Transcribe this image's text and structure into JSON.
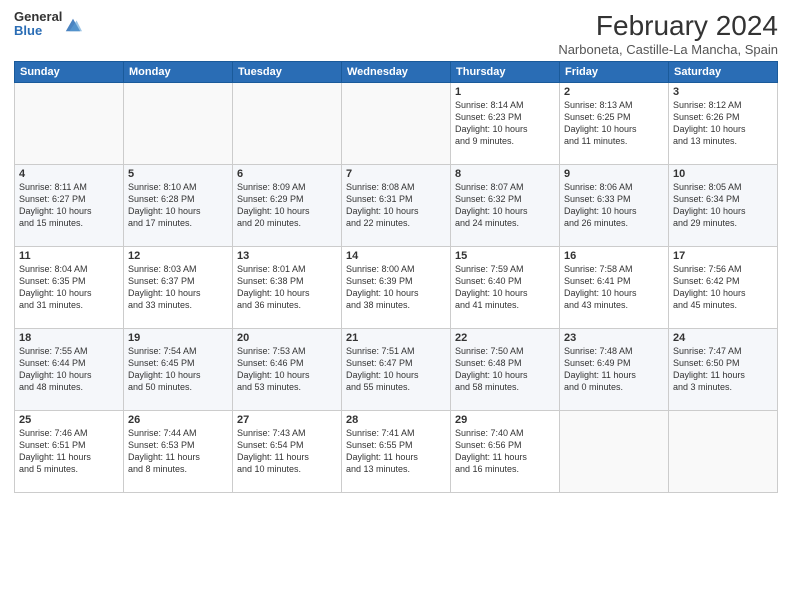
{
  "logo": {
    "general": "General",
    "blue": "Blue"
  },
  "title": "February 2024",
  "subtitle": "Narboneta, Castille-La Mancha, Spain",
  "days_of_week": [
    "Sunday",
    "Monday",
    "Tuesday",
    "Wednesday",
    "Thursday",
    "Friday",
    "Saturday"
  ],
  "weeks": [
    [
      {
        "day": "",
        "info": ""
      },
      {
        "day": "",
        "info": ""
      },
      {
        "day": "",
        "info": ""
      },
      {
        "day": "",
        "info": ""
      },
      {
        "day": "1",
        "info": "Sunrise: 8:14 AM\nSunset: 6:23 PM\nDaylight: 10 hours\nand 9 minutes."
      },
      {
        "day": "2",
        "info": "Sunrise: 8:13 AM\nSunset: 6:25 PM\nDaylight: 10 hours\nand 11 minutes."
      },
      {
        "day": "3",
        "info": "Sunrise: 8:12 AM\nSunset: 6:26 PM\nDaylight: 10 hours\nand 13 minutes."
      }
    ],
    [
      {
        "day": "4",
        "info": "Sunrise: 8:11 AM\nSunset: 6:27 PM\nDaylight: 10 hours\nand 15 minutes."
      },
      {
        "day": "5",
        "info": "Sunrise: 8:10 AM\nSunset: 6:28 PM\nDaylight: 10 hours\nand 17 minutes."
      },
      {
        "day": "6",
        "info": "Sunrise: 8:09 AM\nSunset: 6:29 PM\nDaylight: 10 hours\nand 20 minutes."
      },
      {
        "day": "7",
        "info": "Sunrise: 8:08 AM\nSunset: 6:31 PM\nDaylight: 10 hours\nand 22 minutes."
      },
      {
        "day": "8",
        "info": "Sunrise: 8:07 AM\nSunset: 6:32 PM\nDaylight: 10 hours\nand 24 minutes."
      },
      {
        "day": "9",
        "info": "Sunrise: 8:06 AM\nSunset: 6:33 PM\nDaylight: 10 hours\nand 26 minutes."
      },
      {
        "day": "10",
        "info": "Sunrise: 8:05 AM\nSunset: 6:34 PM\nDaylight: 10 hours\nand 29 minutes."
      }
    ],
    [
      {
        "day": "11",
        "info": "Sunrise: 8:04 AM\nSunset: 6:35 PM\nDaylight: 10 hours\nand 31 minutes."
      },
      {
        "day": "12",
        "info": "Sunrise: 8:03 AM\nSunset: 6:37 PM\nDaylight: 10 hours\nand 33 minutes."
      },
      {
        "day": "13",
        "info": "Sunrise: 8:01 AM\nSunset: 6:38 PM\nDaylight: 10 hours\nand 36 minutes."
      },
      {
        "day": "14",
        "info": "Sunrise: 8:00 AM\nSunset: 6:39 PM\nDaylight: 10 hours\nand 38 minutes."
      },
      {
        "day": "15",
        "info": "Sunrise: 7:59 AM\nSunset: 6:40 PM\nDaylight: 10 hours\nand 41 minutes."
      },
      {
        "day": "16",
        "info": "Sunrise: 7:58 AM\nSunset: 6:41 PM\nDaylight: 10 hours\nand 43 minutes."
      },
      {
        "day": "17",
        "info": "Sunrise: 7:56 AM\nSunset: 6:42 PM\nDaylight: 10 hours\nand 45 minutes."
      }
    ],
    [
      {
        "day": "18",
        "info": "Sunrise: 7:55 AM\nSunset: 6:44 PM\nDaylight: 10 hours\nand 48 minutes."
      },
      {
        "day": "19",
        "info": "Sunrise: 7:54 AM\nSunset: 6:45 PM\nDaylight: 10 hours\nand 50 minutes."
      },
      {
        "day": "20",
        "info": "Sunrise: 7:53 AM\nSunset: 6:46 PM\nDaylight: 10 hours\nand 53 minutes."
      },
      {
        "day": "21",
        "info": "Sunrise: 7:51 AM\nSunset: 6:47 PM\nDaylight: 10 hours\nand 55 minutes."
      },
      {
        "day": "22",
        "info": "Sunrise: 7:50 AM\nSunset: 6:48 PM\nDaylight: 10 hours\nand 58 minutes."
      },
      {
        "day": "23",
        "info": "Sunrise: 7:48 AM\nSunset: 6:49 PM\nDaylight: 11 hours\nand 0 minutes."
      },
      {
        "day": "24",
        "info": "Sunrise: 7:47 AM\nSunset: 6:50 PM\nDaylight: 11 hours\nand 3 minutes."
      }
    ],
    [
      {
        "day": "25",
        "info": "Sunrise: 7:46 AM\nSunset: 6:51 PM\nDaylight: 11 hours\nand 5 minutes."
      },
      {
        "day": "26",
        "info": "Sunrise: 7:44 AM\nSunset: 6:53 PM\nDaylight: 11 hours\nand 8 minutes."
      },
      {
        "day": "27",
        "info": "Sunrise: 7:43 AM\nSunset: 6:54 PM\nDaylight: 11 hours\nand 10 minutes."
      },
      {
        "day": "28",
        "info": "Sunrise: 7:41 AM\nSunset: 6:55 PM\nDaylight: 11 hours\nand 13 minutes."
      },
      {
        "day": "29",
        "info": "Sunrise: 7:40 AM\nSunset: 6:56 PM\nDaylight: 11 hours\nand 16 minutes."
      },
      {
        "day": "",
        "info": ""
      },
      {
        "day": "",
        "info": ""
      }
    ]
  ]
}
